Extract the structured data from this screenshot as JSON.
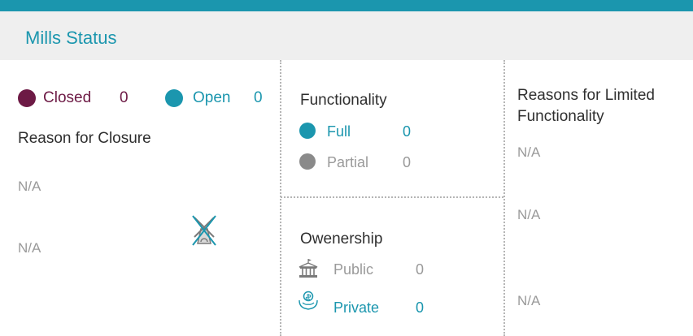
{
  "title": "Mills Status",
  "status": {
    "closed": {
      "label": "Closed",
      "count": "0",
      "color": "#6d1a45"
    },
    "open": {
      "label": "Open",
      "count": "0",
      "color": "#1b96ae"
    }
  },
  "closure": {
    "heading": "Reason for Closure",
    "value1": "N/A",
    "value2": "N/A",
    "icon": "closed-mill-icon"
  },
  "functionality": {
    "heading": "Functionality",
    "full": {
      "label": "Full",
      "count": "0",
      "color": "#1b96ae"
    },
    "partial": {
      "label": "Partial",
      "count": "0",
      "color": "#8a8a8a"
    }
  },
  "ownership": {
    "heading": "Owenership",
    "public": {
      "label": "Public",
      "count": "0",
      "icon": "bank-icon"
    },
    "private": {
      "label": "Private",
      "count": "0",
      "icon": "hand-coin-icon"
    }
  },
  "limited": {
    "heading_line1": "Reasons for Limited",
    "heading_line2": "Functionality",
    "value1": "N/A",
    "value2": "N/A",
    "value3": "N/A"
  }
}
